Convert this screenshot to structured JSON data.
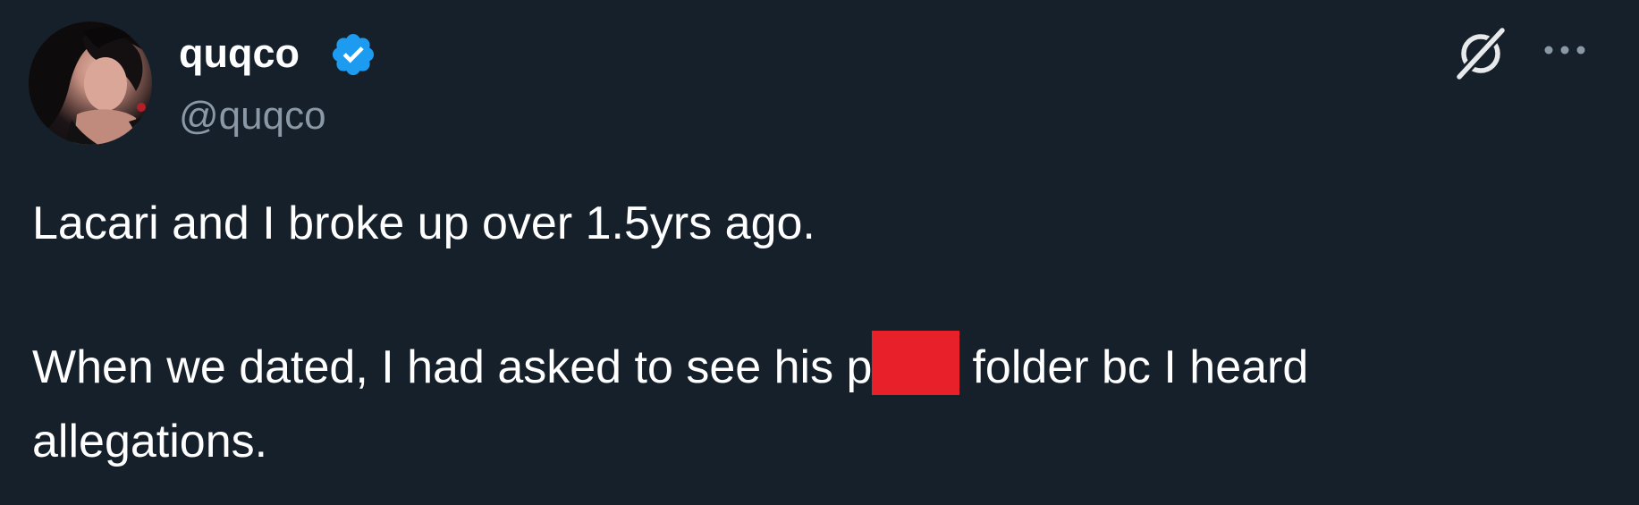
{
  "user": {
    "display_name": "quqco",
    "handle": "@quqco",
    "verified": true,
    "badge_color": "#1d9bf0"
  },
  "actions": {
    "grok_icon": "grok-icon",
    "more_icon": "more-horizontal-icon"
  },
  "tweet": {
    "line1": "Lacari and I broke up over 1.5yrs ago.",
    "line2_before": "When we dated, I had asked to see his p",
    "line2_after": "folder bc I heard",
    "line3": "allegations."
  },
  "colors": {
    "background": "#15202b",
    "text": "#ffffff",
    "secondary_text": "#8b98a5",
    "redaction": "#e8202a"
  }
}
